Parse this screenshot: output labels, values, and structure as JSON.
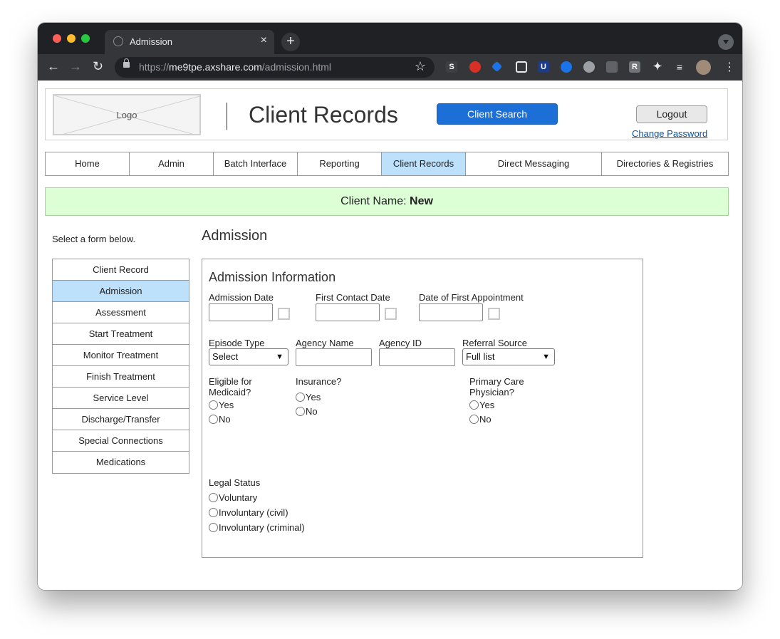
{
  "browser": {
    "tab_title": "Admission",
    "tab_close": "×",
    "new_tab": "+",
    "url_prefix": "https://",
    "url_host": "me9tpe.axshare.com",
    "url_path": "/admission.html",
    "nav_back": "←",
    "nav_forward": "→",
    "nav_reload": "↻",
    "bookmark": "☆",
    "menu": "⋮"
  },
  "header": {
    "logo_text": "Logo",
    "title": "Client Records",
    "search_button": "Client Search",
    "logout_button": "Logout",
    "change_password": "Change Password"
  },
  "main_nav": [
    {
      "label": "Home",
      "active": false
    },
    {
      "label": "Admin",
      "active": false
    },
    {
      "label": "Batch Interface",
      "active": false
    },
    {
      "label": "Reporting",
      "active": false
    },
    {
      "label": "Client Records",
      "active": true
    },
    {
      "label": "Direct Messaging",
      "active": false
    },
    {
      "label": "Directories & Registries",
      "active": false
    }
  ],
  "client": {
    "label": "Client Name:",
    "name": "New"
  },
  "sidebar": {
    "hint": "Select a form below.",
    "items": [
      {
        "label": "Client Record",
        "active": false
      },
      {
        "label": "Admission",
        "active": true
      },
      {
        "label": "Assessment",
        "active": false
      },
      {
        "label": "Start Treatment",
        "active": false
      },
      {
        "label": "Monitor Treatment",
        "active": false
      },
      {
        "label": "Finish Treatment",
        "active": false
      },
      {
        "label": "Service Level",
        "active": false
      },
      {
        "label": "Discharge/Transfer",
        "active": false
      },
      {
        "label": "Special Connections",
        "active": false
      },
      {
        "label": "Medications",
        "active": false
      }
    ]
  },
  "form": {
    "page_title": "Admission",
    "panel_title": "Admission Information",
    "admission_date": {
      "label": "Admission Date",
      "value": ""
    },
    "first_contact_date": {
      "label": "First Contact Date",
      "value": ""
    },
    "first_appointment": {
      "label": "Date of First Appointment",
      "value": ""
    },
    "episode_type": {
      "label": "Episode Type",
      "selected": "Select"
    },
    "agency_name": {
      "label": "Agency Name",
      "value": ""
    },
    "agency_id": {
      "label": "Agency ID",
      "value": ""
    },
    "referral_source": {
      "label": "Referral Source",
      "selected": "Full list"
    },
    "medicaid": {
      "label_line1": "Eligible for",
      "label_line2": "Medicaid?",
      "options": [
        "Yes",
        "No"
      ]
    },
    "insurance": {
      "label": "Insurance?",
      "options": [
        "Yes",
        "No"
      ]
    },
    "pcp": {
      "label_line1": "Primary Care",
      "label_line2": "Physician?",
      "options": [
        "Yes",
        "No"
      ]
    },
    "legal_status": {
      "label": "Legal Status",
      "options": [
        "Voluntary",
        "Involuntary (civil)",
        "Involuntary (criminal)"
      ]
    }
  },
  "colors": {
    "primary_button": "#1d6fd8",
    "active_nav": "#bde0fb",
    "client_banner": "#dcffd6",
    "link": "#0b4f9e"
  }
}
